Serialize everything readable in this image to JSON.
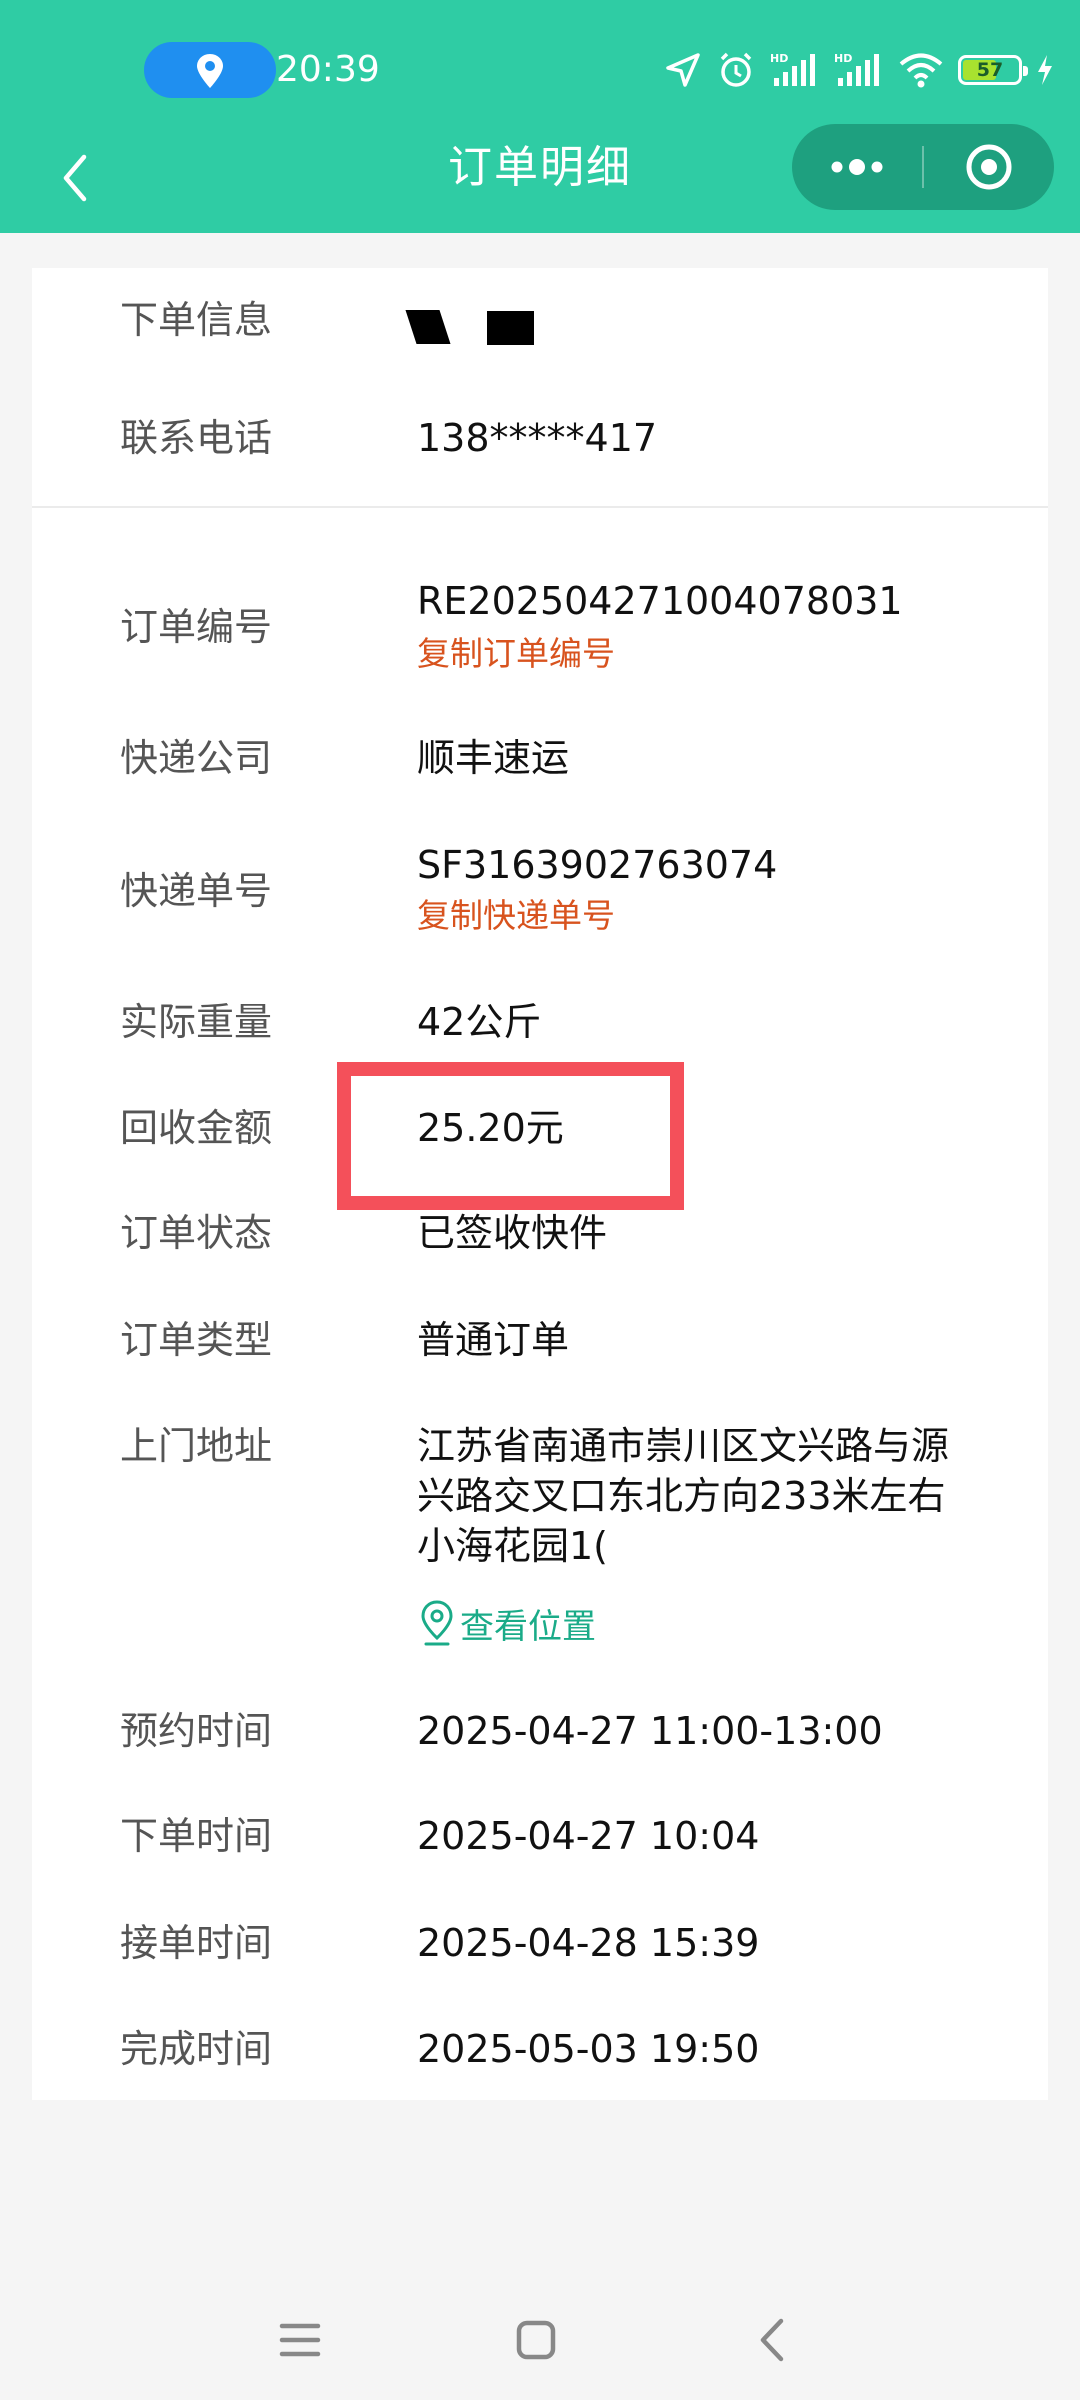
{
  "status_bar": {
    "time": "20:39",
    "battery": "57"
  },
  "nav": {
    "title": "订单明细"
  },
  "contact": {
    "rows": [
      {
        "label": "下单信息",
        "value": ""
      },
      {
        "label": "联系电话",
        "value": "138*****417"
      }
    ]
  },
  "order": {
    "number_label": "订单编号",
    "number_value": "RE20250427100407803 1",
    "copy_order_number": "复制订单编号",
    "courier_label": "快递公司",
    "courier_value": "顺丰速运",
    "tracking_label": "快递单号",
    "tracking_value": "SF3163902763074",
    "copy_tracking_number": "复制快递单号",
    "weight_label": "实际重量",
    "weight_value": "42公斤",
    "amount_label": "回收金额",
    "amount_value": "25.20元",
    "status_label": "订单状态",
    "status_value": "已签收快件",
    "type_label": "订单类型",
    "type_value": "普通订单",
    "address_label": "上门地址",
    "address_lines": [
      "江苏省南通市崇川区文兴路与源",
      "兴路交叉口东北方向233米左右",
      "小海花园1("
    ],
    "view_location": "查看位置",
    "appointment_label": "预约时间",
    "appointment_value": "2025-04-27 11:00-13:00",
    "placed_label": "下单时间",
    "placed_value": "2025-04-27 10:04",
    "accepted_label": "接单时间",
    "accepted_value": "2025-04-28 15:39",
    "completed_label": "完成时间",
    "completed_value": "2025-05-03 19:50"
  },
  "colors": {
    "header": "#2fcca4",
    "accent_orange": "#d8531e",
    "link_green": "#1aab88",
    "highlight_red": "#f4505a"
  },
  "icons": [
    "location-icon",
    "navigation-arrow-icon",
    "alarm-icon",
    "signal-icon",
    "wifi-icon",
    "battery-icon",
    "charging-icon",
    "back-chevron-icon",
    "more-dots-icon",
    "miniapp-close-icon",
    "map-pin-icon",
    "menu-lines-icon",
    "home-square-icon",
    "back-triangle-icon"
  ]
}
